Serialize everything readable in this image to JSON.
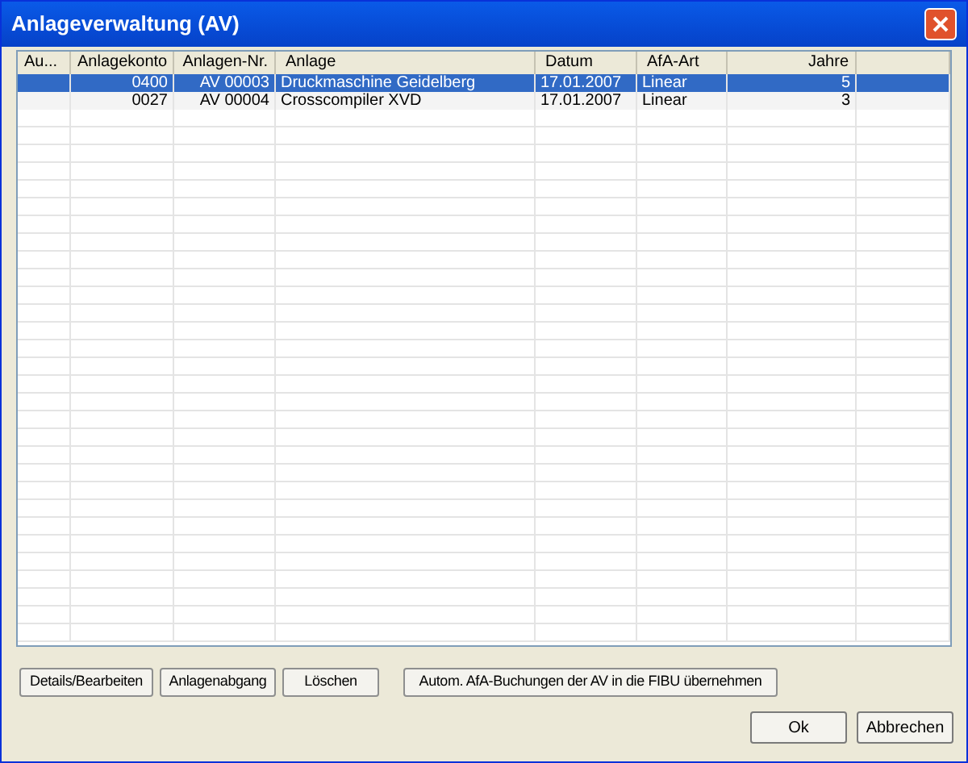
{
  "window": {
    "title": "Anlageverwaltung (AV)"
  },
  "table": {
    "columns": [
      "Au...",
      "Anlagekonto",
      "Anlagen-Nr.",
      "Anlage",
      "Datum",
      "AfA-Art",
      "Jahre"
    ],
    "rows": [
      {
        "selected": true,
        "cells": [
          "",
          "0400",
          "AV 00003",
          "Druckmaschine Geidelberg",
          "17.01.2007",
          "Linear",
          "5"
        ]
      },
      {
        "selected": false,
        "cells": [
          "",
          "0027",
          "AV 00004",
          "Crosscompiler XVD",
          "17.01.2007",
          "Linear",
          "3"
        ]
      }
    ]
  },
  "action_buttons": [
    "Details/Bearbeiten",
    "Anlagenabgang",
    "Löschen",
    "Autom. AfA-Buchungen der AV in die FIBU übernehmen"
  ],
  "dialog_buttons": [
    "Ok",
    "Abbrechen"
  ]
}
